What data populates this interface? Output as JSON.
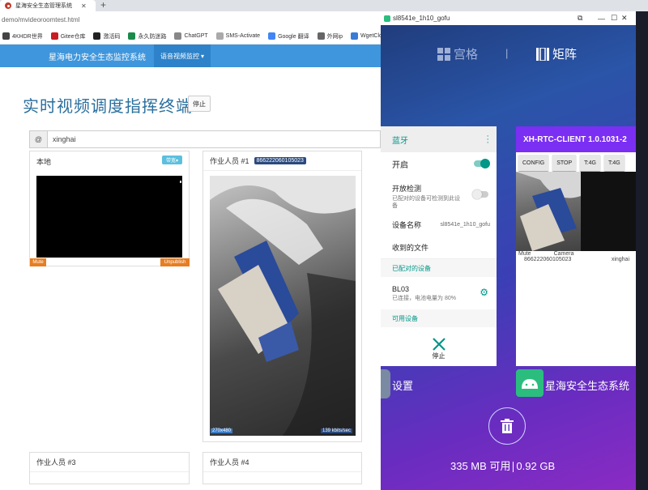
{
  "browser": {
    "tab_title": "星海安全生态管理系统",
    "tab_close": "✕",
    "new_tab": "+",
    "url": "demo/mvideoroomtest.html",
    "bookmarks": [
      {
        "label": "4KHDR世界",
        "color": "#444"
      },
      {
        "label": "Gitee仓库",
        "color": "#c71d23"
      },
      {
        "label": "激活码",
        "color": "#222"
      },
      {
        "label": "永久防迷路",
        "color": "#1a8a4a"
      },
      {
        "label": "ChatGPT",
        "color": "#888"
      },
      {
        "label": "SMS-Activate",
        "color": "#aaa"
      },
      {
        "label": "Google 翻译",
        "color": "#4285f4"
      },
      {
        "label": "外网ip",
        "color": "#666"
      },
      {
        "label": "WgetCloud",
        "color": "#3a7bd5"
      }
    ]
  },
  "nav": {
    "brand": "星海电力安全生态监控系统",
    "item": "语音视频监控",
    "caret": "▾"
  },
  "page": {
    "title": "实时视频调度指挥终端",
    "stop_button": "停止"
  },
  "input": {
    "addon": "@",
    "value": "xinghai"
  },
  "panels": {
    "local": {
      "title": "本地",
      "more_button": "带宽▾",
      "mute": "Mute",
      "unpublish": "Unpublish"
    },
    "worker1": {
      "title": "作业人员 #1",
      "badge": "866222060105023",
      "resolution": "270x480",
      "bitrate": "139 kbits/sec"
    },
    "worker3": {
      "title": "作业人员 #3"
    },
    "worker4": {
      "title": "作业人员 #4"
    }
  },
  "emulator": {
    "window_title": "sl8541e_1h10_gofu",
    "controls": [
      "⧉",
      "—",
      "☐",
      "✕"
    ],
    "view_grid": "宫格",
    "separator": "|",
    "view_matrix": "矩阵",
    "bluetooth": {
      "title": "蓝牙",
      "on_label": "开启",
      "discoverable": "开放检测",
      "discoverable_sub": "已配对的设备可检测到此设备",
      "device_name_label": "设备名称",
      "device_name": "sl8541e_1h10_gofu",
      "received_files": "收到的文件",
      "paired_section": "已配对的设备",
      "paired_device": "BL03",
      "paired_status": "已连接，电池电量为 80%",
      "available_section": "可用设备",
      "stop_label": "停止"
    },
    "rtc": {
      "title": "XH-RTC-CLIENT 1.0.1031-2",
      "buttons": [
        "CONFIG",
        "STOP",
        "T:4G",
        "T:4G"
      ],
      "mute_label": "Mute",
      "camera_label": "Camera",
      "device_id": "866222060105023",
      "user": "xinghai"
    },
    "apps": {
      "settings": "设置",
      "monitor": "星海安全生态系统"
    },
    "memory": {
      "used": "335 MB 可用",
      "total": "0.92 GB"
    }
  },
  "colors": {
    "nav": "#3f96dc",
    "accent_teal": "#009688",
    "rtc_purple": "#7b2ff2",
    "tag_orange": "#e67e22"
  }
}
